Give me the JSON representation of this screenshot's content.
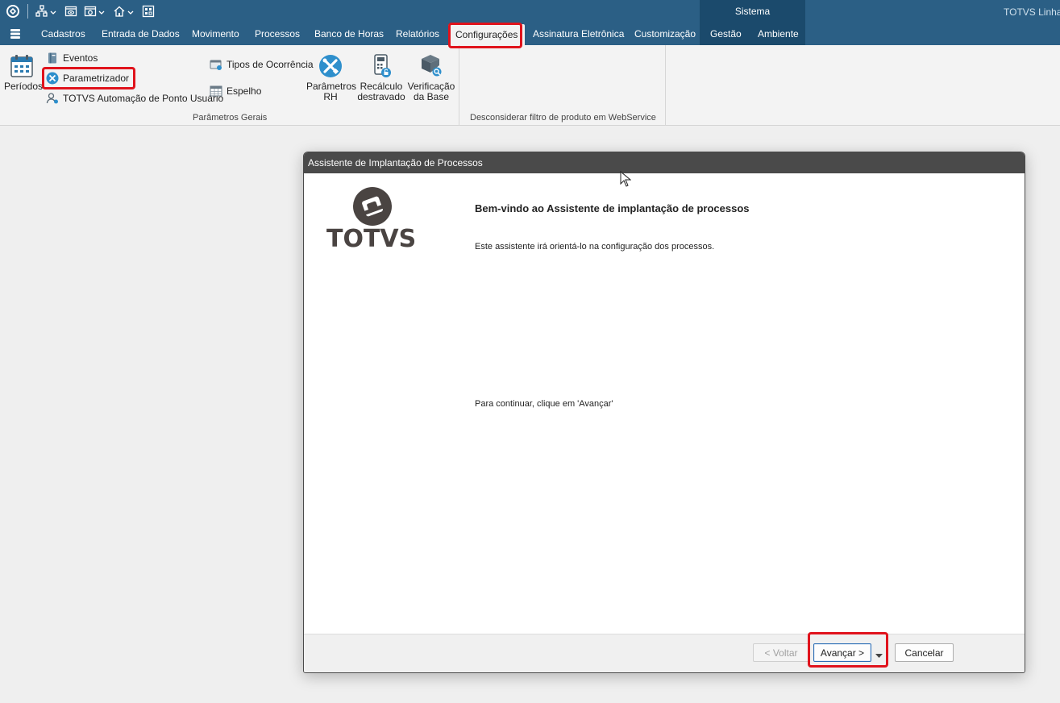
{
  "titlebar": {
    "app_title": "TOTVS Linha R",
    "context_tab": "Sistema",
    "quick_access_icons": [
      "totvs-logo-icon",
      "org-chart-icon",
      "view-icon",
      "settings-window-icon",
      "home-icon",
      "grid-icon"
    ]
  },
  "menu": {
    "items": [
      {
        "label": "Cadastros"
      },
      {
        "label": "Entrada de Dados"
      },
      {
        "label": "Movimento"
      },
      {
        "label": "Processos"
      },
      {
        "label": "Banco de Horas"
      },
      {
        "label": "Relatórios"
      },
      {
        "label": "Configurações",
        "active": true
      },
      {
        "label": "Assinatura Eletrônica"
      },
      {
        "label": "Customização"
      },
      {
        "label": "Gestão"
      },
      {
        "label": "Ambiente"
      }
    ]
  },
  "ribbon": {
    "group1": {
      "label": "Parâmetros Gerais",
      "periodos": "Períodos",
      "eventos": "Eventos",
      "parametrizador": "Parametrizador",
      "automacao": "TOTVS Automação de Ponto Usuário",
      "tipos_ocorrencia": "Tipos de Ocorrência",
      "espelho": "Espelho",
      "parametros_rh_1": "Parâmetros",
      "parametros_rh_2": "RH",
      "recalculo_1": "Recálculo",
      "recalculo_2": "destravado",
      "verificacao_1": "Verificação",
      "verificacao_2": "da Base"
    },
    "group2": {
      "label": "Desconsiderar filtro de produto em WebService"
    }
  },
  "dialog": {
    "title": "Assistente de Implantação de Processos",
    "logo_text": "TOTVS",
    "heading": "Bem-vindo ao Assistente de implantação de processos",
    "intro": "Este assistente irá orientá-lo na configuração dos processos.",
    "continue_text": "Para continuar, clique em 'Avançar'",
    "buttons": {
      "back": "< Voltar",
      "next": "Avançar >",
      "cancel": "Cancelar"
    }
  },
  "colors": {
    "menubar": "#2b5f85",
    "context_tab": "#1b4a6c",
    "highlight": "#e0131c",
    "dialog_title": "#4a4a4a",
    "logo": "#4a4442"
  }
}
